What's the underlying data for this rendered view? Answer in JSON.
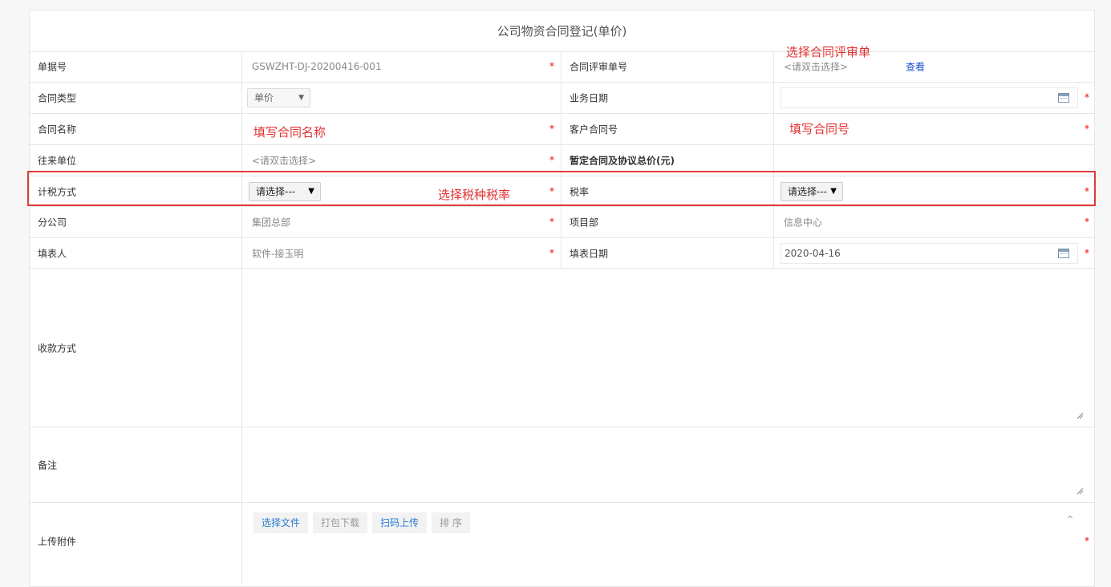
{
  "form_title": "公司物资合同登记(单价)",
  "rows": {
    "doc_no": {
      "label": "单据号",
      "value": "GSWZHT-DJ-20200416-001"
    },
    "review_no": {
      "label": "合同评审单号",
      "placeholder": "<请双击选择>",
      "view_link": "查看"
    },
    "contract_type": {
      "label": "合同类型",
      "selected": "单价"
    },
    "biz_date": {
      "label": "业务日期",
      "value": ""
    },
    "contract_name": {
      "label": "合同名称"
    },
    "customer_contract_no": {
      "label": "客户合同号"
    },
    "counterparty": {
      "label": "往来单位",
      "placeholder": "<请双击选择>"
    },
    "provisional_total": {
      "label": "暂定合同及协议总价(元)"
    },
    "tax_method": {
      "label": "计税方式",
      "selected": "请选择---"
    },
    "tax_rate": {
      "label": "税率",
      "selected": "请选择---"
    },
    "branch": {
      "label": "分公司",
      "value": "集团总部"
    },
    "project_dept": {
      "label": "项目部",
      "value": "信息中心"
    },
    "filler": {
      "label": "填表人",
      "value": "软件-接玉明"
    },
    "fill_date": {
      "label": "填表日期",
      "value": "2020-04-16"
    },
    "payment_method": {
      "label": "收款方式"
    },
    "remarks": {
      "label": "备注"
    },
    "attachments": {
      "label": "上传附件",
      "buttons": [
        "选择文件",
        "打包下载",
        "扫码上传",
        "排 序"
      ]
    }
  },
  "required_mark": "*",
  "annotations": {
    "select_review": "选择合同评审单",
    "fill_name": "填写合同名称",
    "fill_customer_no": "填写合同号",
    "select_tax": "选择税种税率"
  },
  "colors": {
    "annotation": "#e03030",
    "highlight_border": "#e23a3a",
    "link": "#1a4fd6",
    "required": "#ee0000"
  }
}
